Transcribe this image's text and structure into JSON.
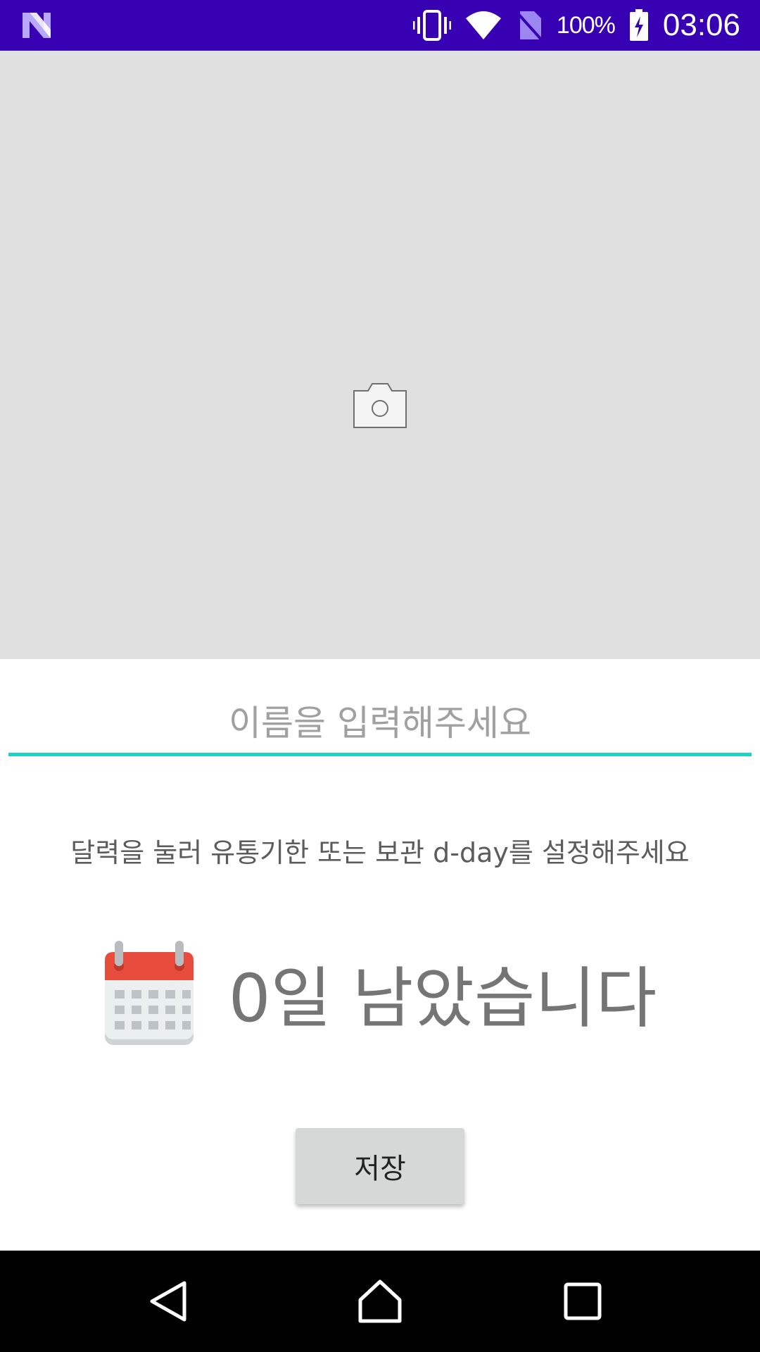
{
  "status_bar": {
    "battery_level": "100%",
    "time": "03:06",
    "icons": [
      "n-logo-icon",
      "vibrate-icon",
      "wifi-icon",
      "no-sim-icon",
      "battery-charging-icon"
    ]
  },
  "photo_picker": {
    "icon": "camera-icon"
  },
  "name_field": {
    "placeholder": "이름을 입력해주세요",
    "value": ""
  },
  "guide_text": "달력을 눌러 유통기한 또는 보관 d-day를 설정해주세요",
  "dday": {
    "icon": "calendar-icon",
    "text": "0일 남았습니다"
  },
  "save_button_label": "저장",
  "nav_bar": {
    "icons": [
      "back-icon",
      "home-icon",
      "recents-icon"
    ]
  },
  "colors": {
    "status_bar": "#3700b3",
    "accent_underline": "#1dd3c8",
    "photo_placeholder": "#e0e0e0",
    "button": "#d6d7d7"
  }
}
